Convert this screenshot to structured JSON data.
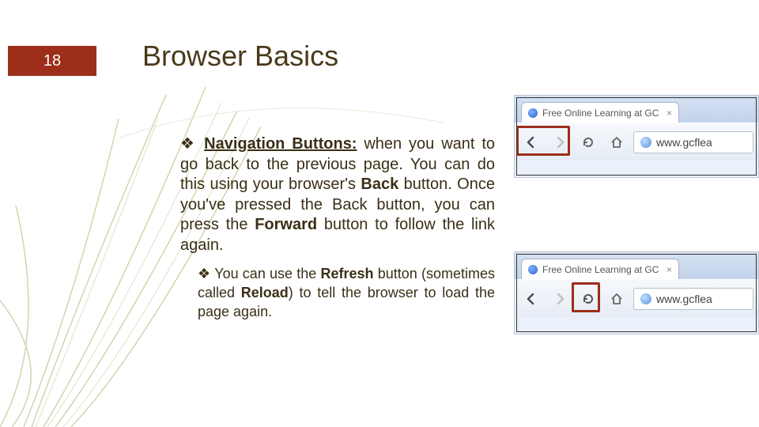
{
  "page_number": "18",
  "title": "Browser Basics",
  "bullet1": {
    "marker": "❖",
    "lead": "Navigation Buttons:",
    "text_a": " when you want to go back to the previous page. You can do this using your browser's ",
    "back": "Back",
    "text_b": " button. Once you've pressed the Back button, you can press the ",
    "forward": "Forward",
    "text_c": " button to follow the link again."
  },
  "bullet2": {
    "marker": "❖",
    "text_a": " You can use the ",
    "refresh": "Refresh",
    "text_b": " button (sometimes called ",
    "reload": "Reload",
    "text_c": ") to tell the browser to load the page again."
  },
  "illus": {
    "tab_title": "Free Online Learning at GC",
    "tab_close": "×",
    "url": "www.gcflea"
  },
  "colors": {
    "accent": "#9c2e1a",
    "text": "#3a2f16"
  }
}
